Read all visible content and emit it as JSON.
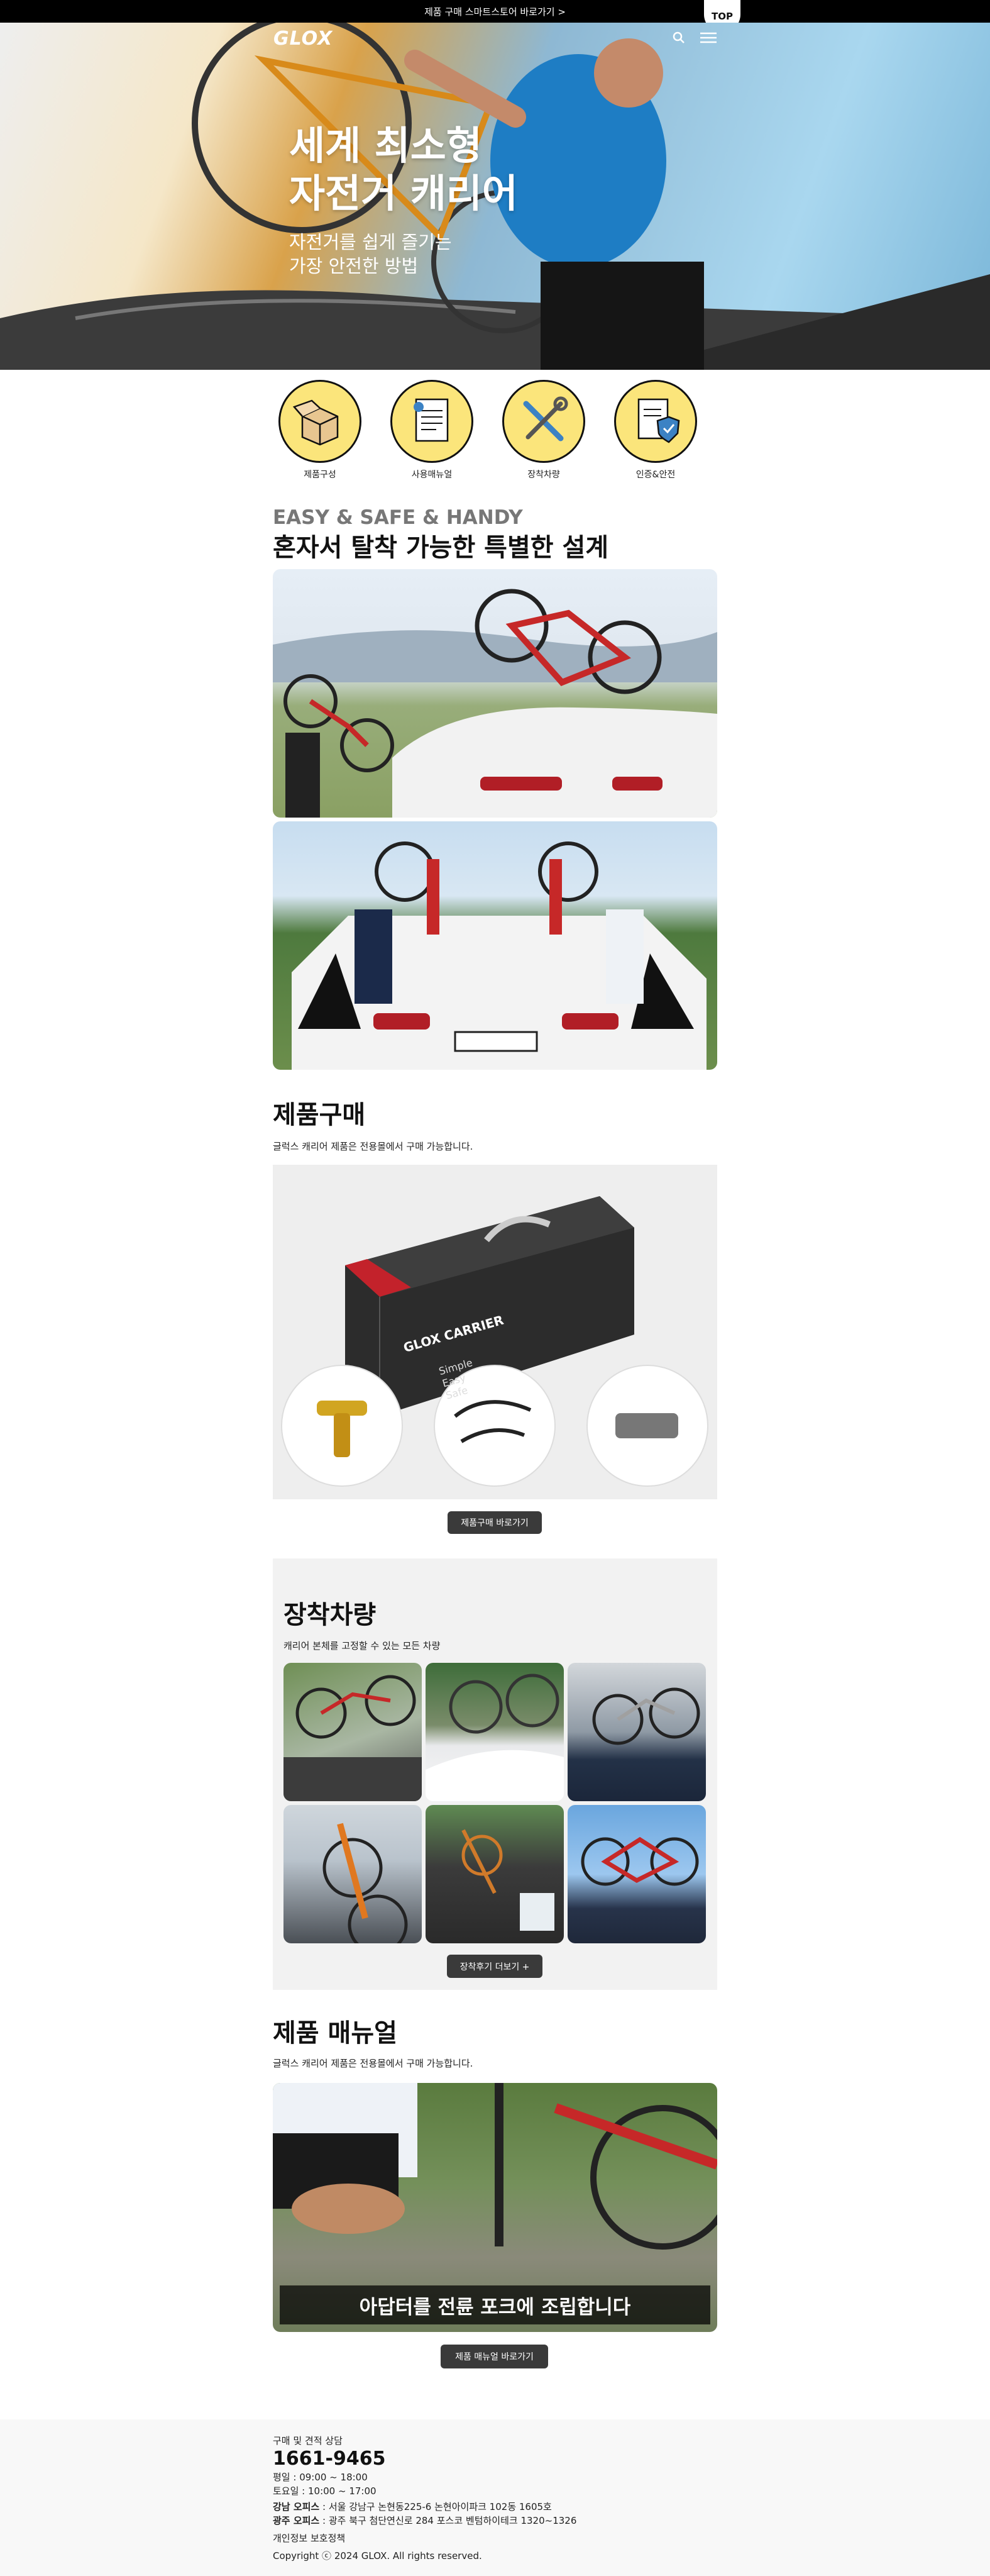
{
  "topbar": {
    "text": "제품 구매 스마트스토어 바로가기 >",
    "top_label": "TOP"
  },
  "header": {
    "logo": "GLOX",
    "search_icon": "search-icon",
    "menu_icon": "hamburger-menu-icon"
  },
  "hero": {
    "title": "세계 최소형\n자전거 캐리어",
    "subtitle": "자전거를 쉽게 즐기는\n가장 안전한 방법"
  },
  "categories": [
    {
      "label": "제품구성",
      "icon": "box-icon"
    },
    {
      "label": "사용매뉴얼",
      "icon": "document-icon"
    },
    {
      "label": "장착차량",
      "icon": "tools-icon"
    },
    {
      "label": "인증&안전",
      "icon": "shield-document-icon"
    }
  ],
  "design": {
    "eyebrow": "EASY & SAFE & HANDY",
    "title": "혼자서 탈착 가능한 특별한 설계"
  },
  "purchase": {
    "title": "제품구매",
    "desc": "글럭스 캐리어 제품은 전용몰에서 구매 가능합니다.",
    "box_brand": "GLOX CARRIER",
    "box_text": "Simple\nEasy\nSafe",
    "button": "제품구매 바로가기"
  },
  "vehicles": {
    "title": "장착차량",
    "desc": "캐리어 본체를 고정할 수 있는 모든 차량",
    "button": "장착후기 더보기 +"
  },
  "manual": {
    "title": "제품 매뉴얼",
    "desc": "글럭스 캐리어 제품은 전용몰에서 구매 가능합니다.",
    "caption": "아답터를 전륜 포크에 조립합니다",
    "button": "제품 매뉴얼 바로가기"
  },
  "footer": {
    "consult": "구매 및 견적 상담",
    "phone": "1661-9465",
    "weekday": "평일 : 09:00 ~ 18:00",
    "saturday": "토요일 : 10:00 ~ 17:00",
    "office1_label": "강남 오피스",
    "office1": " : 서울 강남구 논현동225-6 논현아이파크 102동 1605호",
    "office2_label": "광주 오피스",
    "office2": " : 광주 북구 첨단연신로 284 포스코 벤텀하이테크 1320~1326",
    "privacy": "개인정보 보호정책",
    "copyright": "Copyright ⓒ 2024 GLOX. All rights reserved."
  },
  "colors": {
    "accent_yellow": "#fbe57b",
    "button_dark": "#3a3a3a",
    "sky_blue": "#a9d7ef"
  }
}
